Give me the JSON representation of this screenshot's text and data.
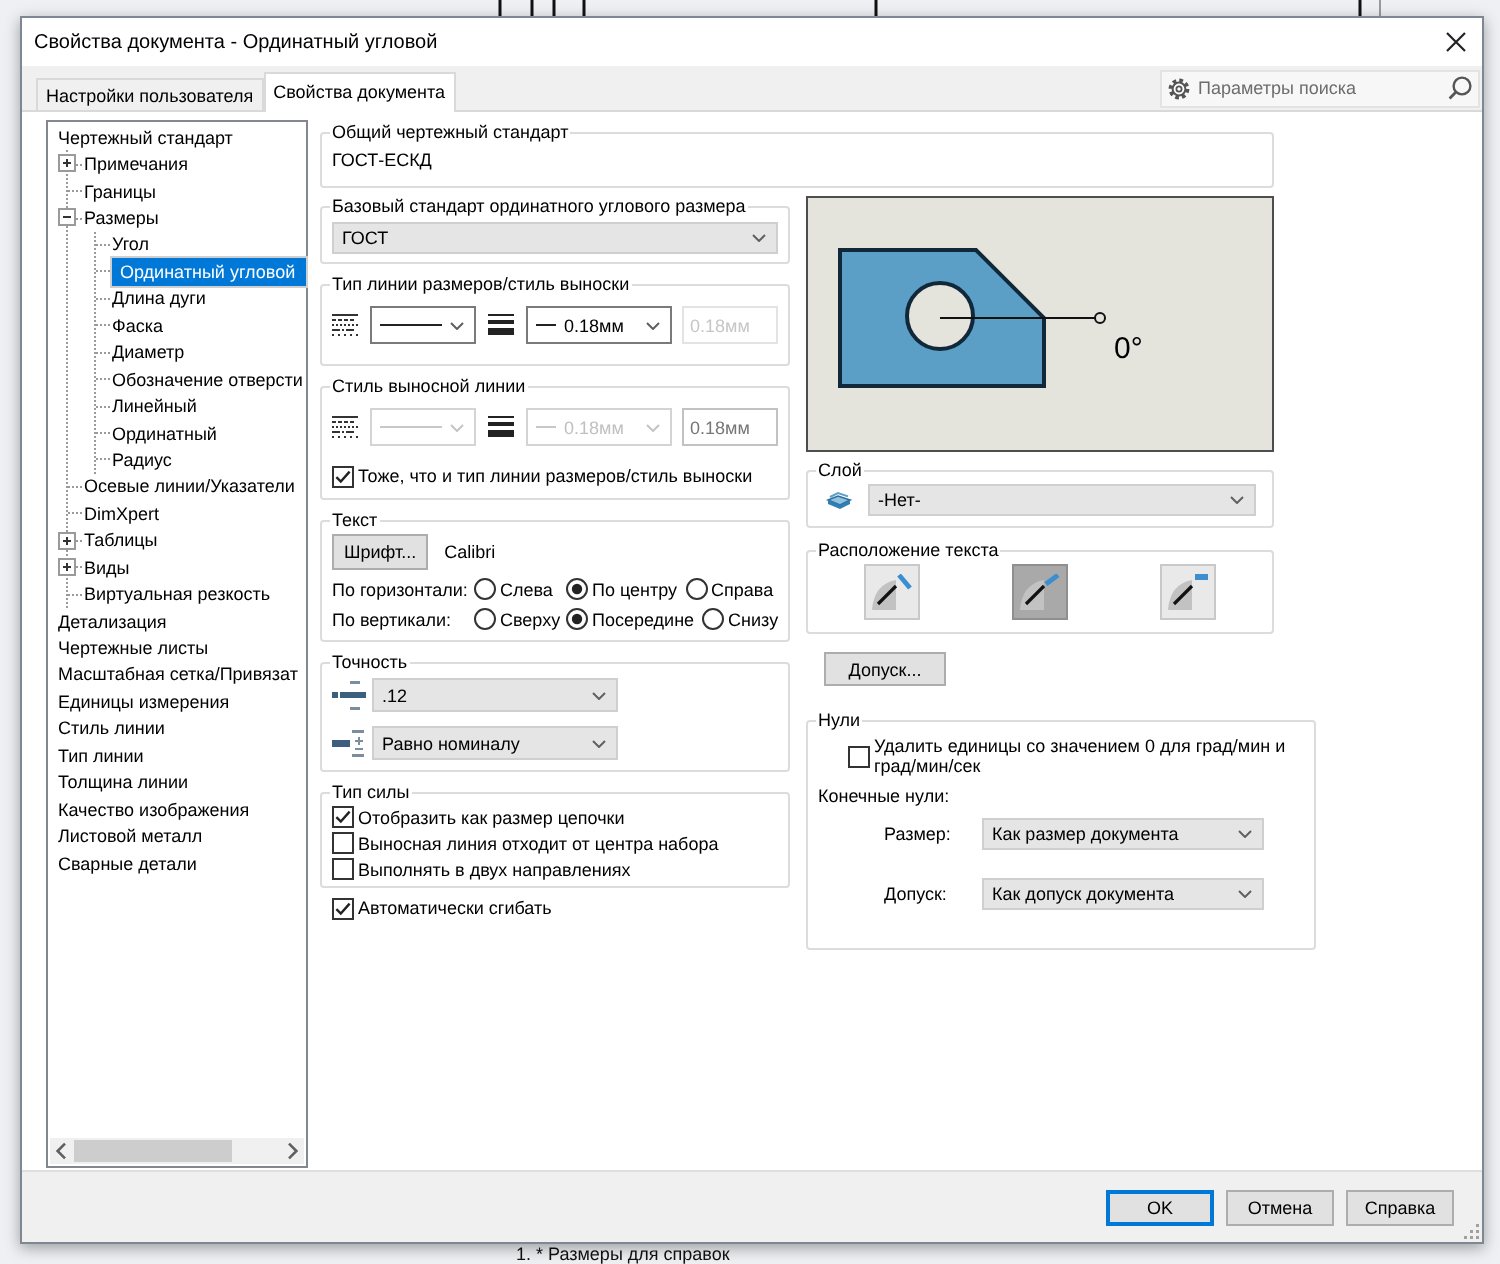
{
  "window": {
    "title": "Свойства документа - Ординатный угловой"
  },
  "tabs": [
    {
      "label": "Настройки пользователя",
      "selected": false
    },
    {
      "label": "Свойства документа",
      "selected": true
    }
  ],
  "search": {
    "placeholder": "Параметры поиска"
  },
  "tree": [
    {
      "label": "Чертежный стандарт",
      "selected": false,
      "children": [
        {
          "label": "Примечания",
          "selected": false,
          "expanded": false
        },
        {
          "label": "Границы",
          "selected": false
        },
        {
          "label": "Размеры",
          "selected": false,
          "expanded": true,
          "children": [
            {
              "label": "Угол",
              "selected": false
            },
            {
              "label": "Ординатный угловой",
              "selected": true
            },
            {
              "label": "Длина дуги",
              "selected": false
            },
            {
              "label": "Фаска",
              "selected": false
            },
            {
              "label": "Диаметр",
              "selected": false
            },
            {
              "label": "Обозначение отверсти",
              "selected": false
            },
            {
              "label": "Линейный",
              "selected": false
            },
            {
              "label": "Ординатный",
              "selected": false
            },
            {
              "label": "Радиус",
              "selected": false
            }
          ]
        },
        {
          "label": "Осевые линии/Указатели",
          "selected": false
        },
        {
          "label": "DimXpert",
          "selected": false
        },
        {
          "label": "Таблицы",
          "selected": false,
          "expanded": false
        },
        {
          "label": "Виды",
          "selected": false,
          "expanded": false
        },
        {
          "label": "Виртуальная резкость",
          "selected": false
        }
      ]
    },
    {
      "label": "Детализация",
      "selected": false
    },
    {
      "label": "Чертежные листы",
      "selected": false
    },
    {
      "label": "Масштабная сетка/Привязат",
      "selected": false
    },
    {
      "label": "Единицы измерения",
      "selected": false
    },
    {
      "label": "Стиль линии",
      "selected": false
    },
    {
      "label": "Тип линии",
      "selected": false
    },
    {
      "label": "Толщина линии",
      "selected": false
    },
    {
      "label": "Качество изображения",
      "selected": false
    },
    {
      "label": "Листовой металл",
      "selected": false
    },
    {
      "label": "Сварные детали",
      "selected": false
    }
  ],
  "general_standard": {
    "label": "Общий чертежный стандарт",
    "value": "ГОСТ-ЕСКД"
  },
  "base_standard": {
    "label": "Базовый стандарт ординатного углового размера",
    "value": "ГОСТ"
  },
  "dimension_line_style": {
    "label": "Тип линии размеров/стиль выноски",
    "style_disabled": false,
    "weight": "0.18мм",
    "weight_disabled": false,
    "custom_weight": "0.18мм",
    "custom_disabled": true
  },
  "leader_line_style": {
    "label": "Стиль выносной линии",
    "style_disabled": true,
    "weight": "0.18мм",
    "weight_disabled": true,
    "custom_weight": "0.18мм",
    "custom_disabled": false,
    "same_as": {
      "label": "Тоже, что и тип линии размеров/стиль выноски",
      "checked": true
    }
  },
  "text": {
    "label": "Текст",
    "font_button": "Шрифт...",
    "font_name": "Calibri",
    "alignments": [
      {
        "label": "По горизонтали:",
        "options": [
          {
            "label": "Слева",
            "selected": false
          },
          {
            "label": "По центру",
            "selected": true
          },
          {
            "label": "Справа",
            "selected": false
          }
        ]
      },
      {
        "label": "По вертикали:",
        "options": [
          {
            "label": "Сверху",
            "selected": false
          },
          {
            "label": "Посередине",
            "selected": true
          },
          {
            "label": "Снизу",
            "selected": false
          }
        ]
      }
    ]
  },
  "precision": {
    "label": "Точность",
    "rows": [
      {
        "kind": "decimals",
        "value": ".12"
      },
      {
        "kind": "tolerance",
        "value": "Равно номиналу"
      }
    ]
  },
  "force_type": {
    "label": "Тип силы",
    "options": [
      {
        "label": "Отобразить как размер цепочки",
        "checked": true
      },
      {
        "label": "Выносная линия отходит от центра набора",
        "checked": false
      },
      {
        "label": "Выполнять в двух направлениях",
        "checked": false
      }
    ]
  },
  "auto_bend": {
    "label": "Автоматически сгибать",
    "checked": true
  },
  "preview": {
    "angle_label": "0°"
  },
  "layer": {
    "label": "Слой",
    "value": "-Нет-"
  },
  "text_position": {
    "label": "Расположение текста",
    "options": [
      {
        "kind": "angled",
        "selected": false
      },
      {
        "kind": "aligned",
        "selected": true
      },
      {
        "kind": "horizontal",
        "selected": false
      }
    ]
  },
  "tolerance_button": "Допуск...",
  "zeros": {
    "label": "Нули",
    "remove_units": {
      "label": "Удалить единицы со значением 0 для град/мин и град/мин/сек",
      "checked": false
    },
    "trailing_label": "Конечные нули:",
    "rows": [
      {
        "label": "Размер:",
        "value": "Как размер документа"
      },
      {
        "label": "Допуск:",
        "value": "Как допуск документа"
      }
    ]
  },
  "buttons": [
    {
      "label": "OK",
      "default": true
    },
    {
      "label": "Отмена",
      "default": false
    },
    {
      "label": "Справка",
      "default": false
    }
  ],
  "background_note": "1. * Размеры для справок"
}
